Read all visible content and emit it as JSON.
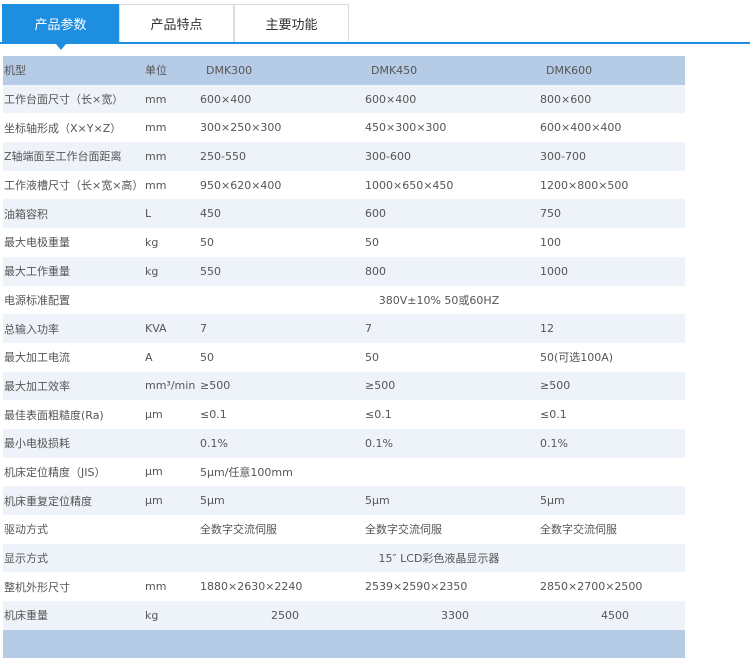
{
  "tabs": [
    {
      "label": "产品参数"
    },
    {
      "label": "产品特点"
    },
    {
      "label": "主要功能"
    }
  ],
  "table": {
    "header": [
      "机型",
      "单位",
      "DMK300",
      "DMK450",
      "DMK600"
    ],
    "rows": [
      [
        "工作台面尺寸（长×宽）",
        "mm",
        "600×400",
        "600×400",
        "800×600"
      ],
      [
        "坐标轴形成（X×Y×Z）",
        "mm",
        "300×250×300",
        "450×300×300",
        "600×400×400"
      ],
      [
        "Z轴端面至工作台面距离",
        "mm",
        "250-550",
        "300-600",
        "300-700"
      ],
      [
        "工作液槽尺寸（长×宽×高）",
        "mm",
        "950×620×400",
        "1000×650×450",
        "1200×800×500"
      ],
      [
        "油箱容积",
        "L",
        "450",
        "600",
        "750"
      ],
      [
        "最大电极重量",
        " kg",
        "50",
        "50",
        "100"
      ],
      [
        "最大工作重量",
        "kg",
        "550",
        "800",
        "1000"
      ],
      [
        "电源标准配置",
        "",
        "380V±10% 50或60HZ",
        "",
        ""
      ],
      [
        "总输入功率",
        "KVA",
        "7",
        "7",
        "12"
      ],
      [
        "最大加工电流",
        "A",
        "50",
        "50",
        "50(可选100A)"
      ],
      [
        "最大加工效率",
        "mm³/min",
        "≥500",
        "≥500",
        "≥500"
      ],
      [
        "最佳表面粗糙度(Ra)",
        "μm",
        "≤0.1",
        "≤0.1",
        "≤0.1"
      ],
      [
        "最小电极损耗",
        "",
        "0.1%",
        "0.1%",
        "0.1%"
      ],
      [
        "机床定位精度（JIS）",
        "μm",
        "5μm/任意100mm",
        "",
        ""
      ],
      [
        "机床重复定位精度",
        "μm",
        "5μm",
        "5μm",
        "5μm"
      ],
      [
        "驱动方式",
        "",
        "全数字交流伺服",
        "全数字交流伺服",
        "全数字交流伺服"
      ],
      [
        "显示方式",
        "",
        "15″ LCD彩色液晶显示器",
        "",
        ""
      ],
      [
        "整机外形尺寸",
        "mm",
        "1880×2630×2240",
        "2539×2590×2350",
        "2850×2700×2500"
      ],
      [
        "机床重量",
        "kg",
        "2500",
        "3300",
        "4500"
      ]
    ]
  },
  "colors": {
    "accent": "#1d8ee0",
    "header_bg": "#b5cbe6",
    "row_shade": "#eef3fa"
  }
}
